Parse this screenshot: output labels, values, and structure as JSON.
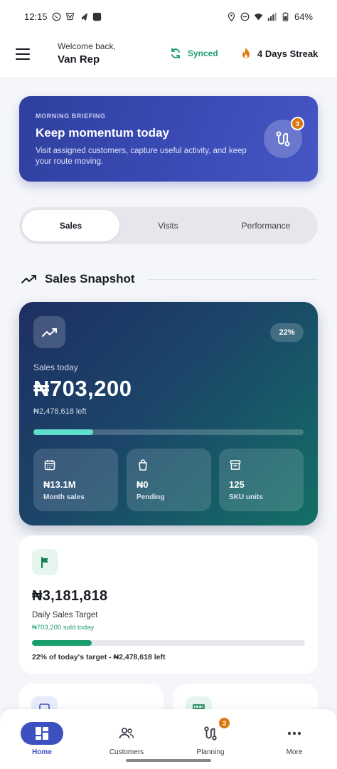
{
  "status_bar": {
    "time": "12:15",
    "battery": "64%"
  },
  "header": {
    "welcome": "Welcome back,",
    "user_name": "Van Rep",
    "sync_status": "Synced",
    "streak": "4 Days Streak"
  },
  "briefing": {
    "kicker": "MORNING BRIEFING",
    "title": "Keep momentum today",
    "description": "Visit assigned customers, capture useful activity, and keep your route moving.",
    "badge_count": "3"
  },
  "tabs": [
    {
      "label": "Sales",
      "active": true
    },
    {
      "label": "Visits",
      "active": false
    },
    {
      "label": "Performance",
      "active": false
    }
  ],
  "section": {
    "title": "Sales Snapshot"
  },
  "snapshot": {
    "percent": "22%",
    "progress": 0.22,
    "label": "Sales today",
    "value": "₦703,200",
    "left": "₦2,478,618 left",
    "stats": [
      {
        "icon": "calendar-icon",
        "value": "₦13.1M",
        "label": "Month sales"
      },
      {
        "icon": "bag-icon",
        "value": "₦0",
        "label": "Pending"
      },
      {
        "icon": "archive-box-icon",
        "value": "125",
        "label": "SKU units"
      }
    ]
  },
  "target": {
    "value": "₦3,181,818",
    "label": "Daily Sales Target",
    "sold": "₦703,200 sold today",
    "progress": 0.22,
    "note": "22% of today's target - ₦2,478,618 left"
  },
  "nav": [
    {
      "label": "Home",
      "icon": "home-grid-icon",
      "active": true
    },
    {
      "label": "Customers",
      "icon": "people-icon",
      "active": false
    },
    {
      "label": "Planning",
      "icon": "route-icon",
      "active": false,
      "badge": "3"
    },
    {
      "label": "More",
      "icon": "more-dots-icon",
      "active": false
    }
  ],
  "colors": {
    "brand_blue": "#3d50c0",
    "accent_green": "#1f9d6b",
    "streak_orange": "#d9780f"
  }
}
